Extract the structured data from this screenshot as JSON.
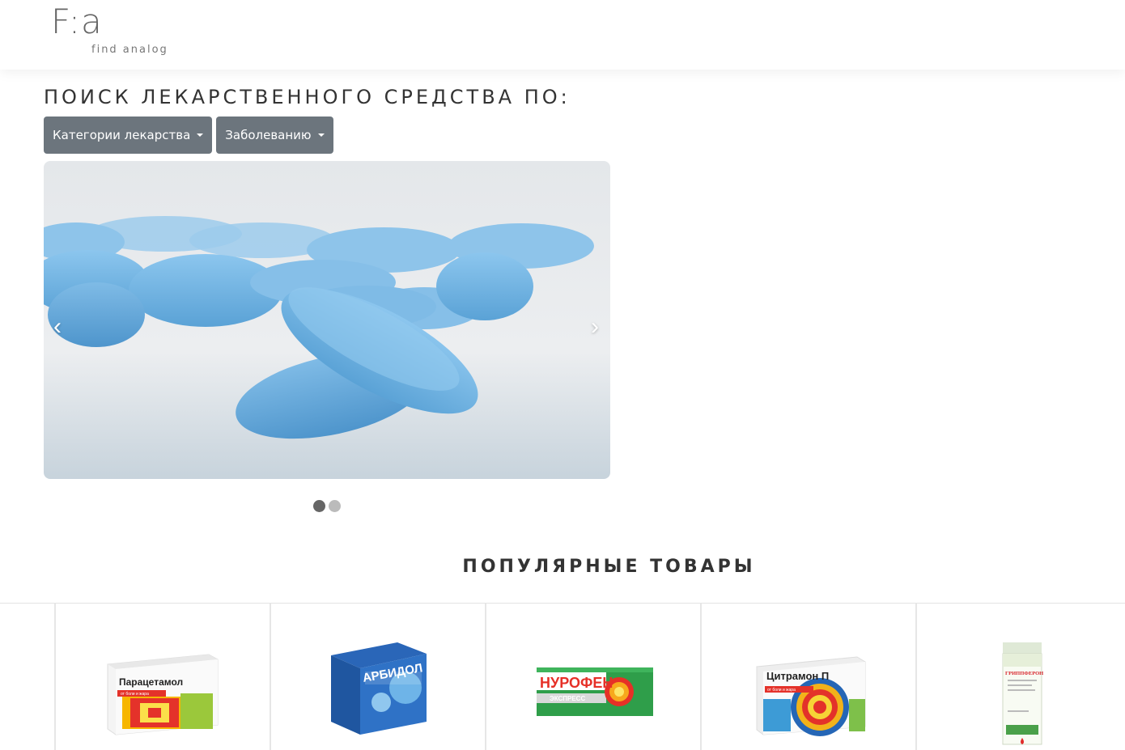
{
  "logo": {
    "mark": "F:a",
    "subtitle": "find analog"
  },
  "search": {
    "title": "ПОИСК ЛЕКАРСТВЕННОГО СРЕДСТВА ПО:",
    "buttons": [
      {
        "label": "Категории лекарства",
        "icon": "caret-down-icon"
      },
      {
        "label": "Заболеванию",
        "icon": "caret-down-icon"
      }
    ]
  },
  "carousel": {
    "prev": "‹",
    "next": "›",
    "slides": 2,
    "active_slide": 1
  },
  "popular": {
    "title": "ПОПУЛЯРНЫЕ ТОВАРЫ",
    "products": [
      {
        "box_text": "Парацетамол",
        "tag": "от боли и жара"
      },
      {
        "box_text": "АРБИДОЛ"
      },
      {
        "box_text": "НУРОФЕН",
        "tag": "ЭКСПРЕСС"
      },
      {
        "box_text": "Цитрамон П",
        "tag": "от боли и жара"
      },
      {
        "box_text": "ГРИППФЕРОН"
      }
    ]
  },
  "colors": {
    "button_bg": "#6c757d",
    "pill_blue": "#6fb3e3",
    "dot_active": "#666666",
    "dot_inactive": "#bbbbbb"
  }
}
